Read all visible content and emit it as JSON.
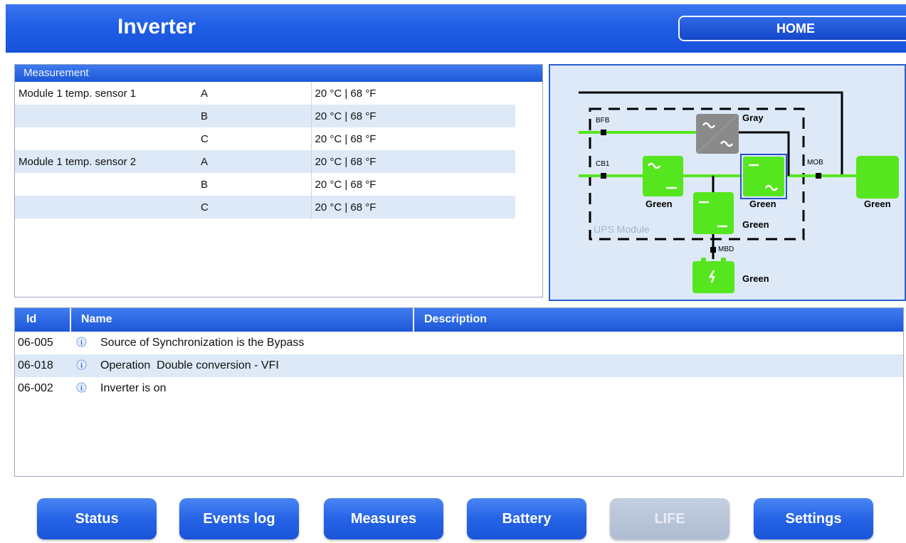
{
  "header": {
    "title": "Inverter",
    "home_label": "HOME"
  },
  "measurement": {
    "title": "Measurement",
    "rows": [
      {
        "sensor": "Module 1 temp. sensor 1",
        "phase": "A",
        "value": "20 °C | 68 °F"
      },
      {
        "sensor": "",
        "phase": "B",
        "value": "20 °C | 68 °F"
      },
      {
        "sensor": "",
        "phase": "C",
        "value": "20 °C | 68 °F"
      },
      {
        "sensor": "Module 1 temp. sensor 2",
        "phase": "A",
        "value": "20 °C | 68 °F"
      },
      {
        "sensor": "",
        "phase": "B",
        "value": "20 °C | 68 °F"
      },
      {
        "sensor": "",
        "phase": "C",
        "value": "20 °C | 68 °F"
      }
    ]
  },
  "diagram": {
    "bfb": "BFB",
    "cb1": "CB1",
    "mob": "MOB",
    "mbd": "MBD",
    "module_label": "UPS Module",
    "bypass_status": "Gray",
    "rectifier_status": "Green",
    "inverter_status": "Green",
    "load_status": "Green",
    "charger_status": "Green",
    "battery_status": "Green",
    "colors": {
      "active": "#56e61f",
      "inactive": "#8a8a8a",
      "frame": "#2a5fd2"
    }
  },
  "events": {
    "headers": {
      "id": "Id",
      "name": "Name",
      "description": "Description"
    },
    "rows": [
      {
        "id": "06-005",
        "name": "Source of Synchronization is the Bypass",
        "icon": "info-icon"
      },
      {
        "id": "06-018",
        "name": "Operation  Double conversion - VFI",
        "icon": "info-icon"
      },
      {
        "id": "06-002",
        "name": "Inverter is on",
        "icon": "info-icon"
      }
    ]
  },
  "nav": {
    "status": "Status",
    "events_log": "Events log",
    "measures": "Measures",
    "battery": "Battery",
    "life": "LIFE",
    "settings": "Settings"
  }
}
